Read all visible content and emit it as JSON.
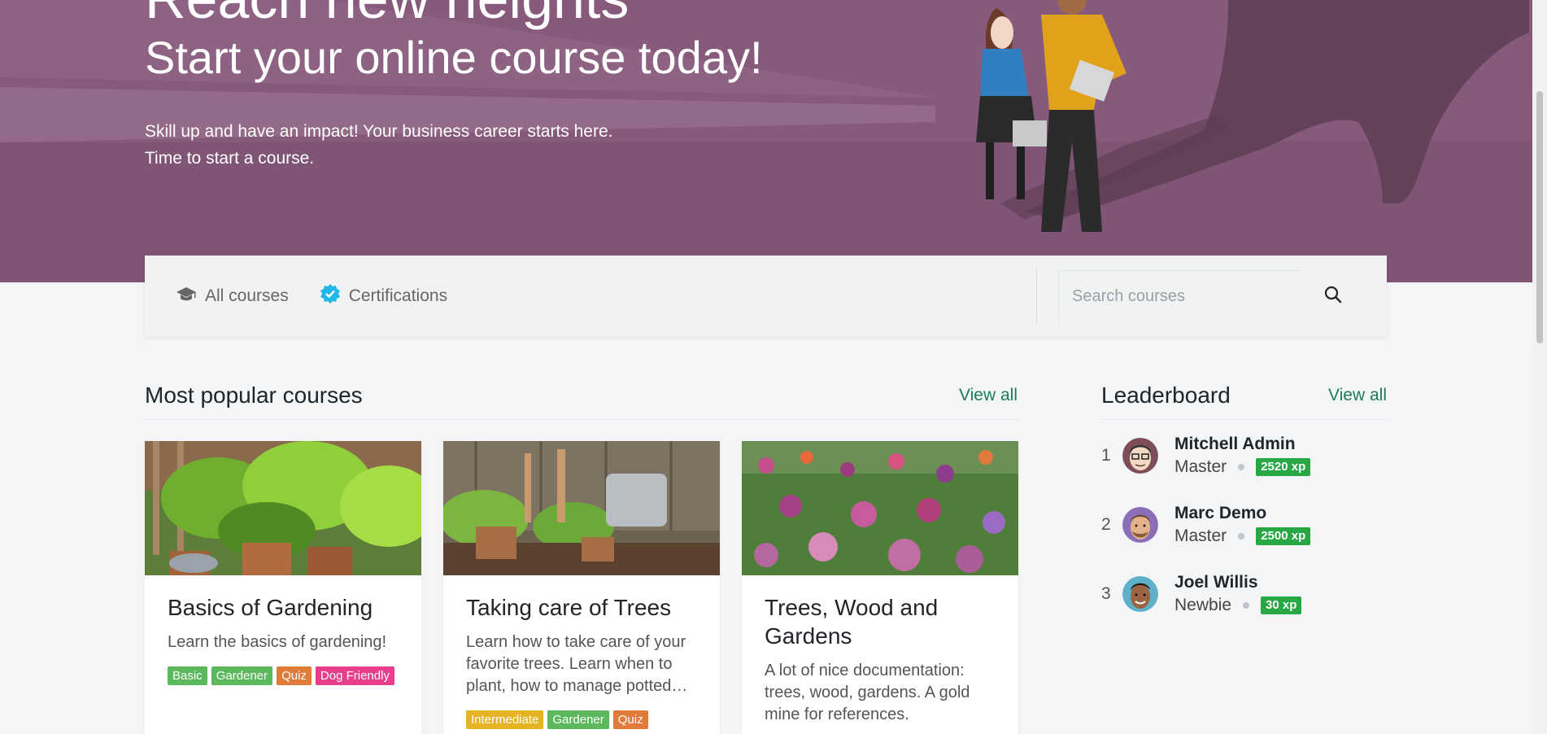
{
  "hero": {
    "title_cut": "Reach new heights",
    "title": "Start your online course today!",
    "subtitle_line1": "Skill up and have an impact! Your business career starts here.",
    "subtitle_line2": "Time to start a course."
  },
  "nav": {
    "all_courses": "All courses",
    "certifications": "Certifications",
    "search_placeholder": "Search courses"
  },
  "popular": {
    "title": "Most popular courses",
    "view_all": "View all",
    "courses": [
      {
        "title": "Basics of Gardening",
        "description": "Learn the basics of gardening!",
        "tags": [
          {
            "label": "Basic",
            "color": "#5cb85c"
          },
          {
            "label": "Gardener",
            "color": "#5cb85c"
          },
          {
            "label": "Quiz",
            "color": "#e07b39"
          },
          {
            "label": "Dog Friendly",
            "color": "#e83e8c"
          }
        ]
      },
      {
        "title": "Taking care of Trees",
        "description": "Learn how to take care of your favorite trees. Learn when to plant, how to manage potted…",
        "tags": [
          {
            "label": "Intermediate",
            "color": "#e6b422"
          },
          {
            "label": "Gardener",
            "color": "#5cb85c"
          },
          {
            "label": "Quiz",
            "color": "#e07b39"
          }
        ]
      },
      {
        "title": "Trees, Wood and Gardens",
        "description": "A lot of nice documentation: trees, wood, gardens. A gold mine for references.",
        "tags": []
      }
    ]
  },
  "leaderboard": {
    "title": "Leaderboard",
    "view_all": "View all",
    "entries": [
      {
        "rank": "1",
        "name": "Mitchell Admin",
        "level": "Master",
        "xp": "2520 xp"
      },
      {
        "rank": "2",
        "name": "Marc Demo",
        "level": "Master",
        "xp": "2500 xp"
      },
      {
        "rank": "3",
        "name": "Joel Willis",
        "level": "Newbie",
        "xp": "30 xp"
      }
    ]
  },
  "colors": {
    "hero_bg": "#875a7b",
    "link": "#1e7a5c",
    "xp_badge": "#28a745",
    "cert_icon": "#20b8e8"
  }
}
